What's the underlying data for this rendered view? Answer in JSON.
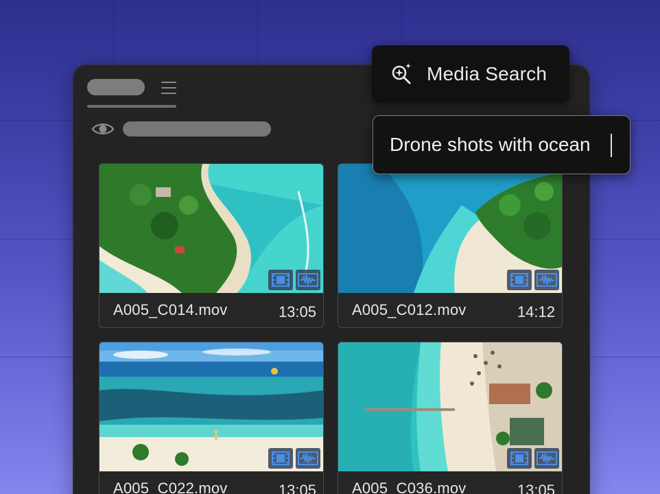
{
  "tooltip": {
    "label": "Media Search",
    "icon": "sparkle-search-icon"
  },
  "search": {
    "query": "Drone shots with ocean"
  },
  "panel": {
    "view_icon": "eye-icon",
    "menu_icon": "hamburger-menu-icon"
  },
  "clips": [
    {
      "filename": "A005_C014.mov",
      "duration": "13:05",
      "badges": [
        "film-icon",
        "audio-waveform-icon"
      ]
    },
    {
      "filename": "A005_C012.mov",
      "duration": "14:12",
      "badges": [
        "film-icon",
        "audio-waveform-icon"
      ]
    },
    {
      "filename": "A005_C022.mov",
      "duration": "13:05",
      "badges": [
        "film-icon",
        "audio-waveform-icon"
      ]
    },
    {
      "filename": "A005_C036.mov",
      "duration": "13:05",
      "badges": [
        "film-icon",
        "audio-waveform-icon"
      ]
    }
  ],
  "colors": {
    "accent_badge": "#4a8fe8",
    "panel_bg": "#232323",
    "background_top": "#2f2f8e",
    "background_bottom": "#8585ee"
  }
}
